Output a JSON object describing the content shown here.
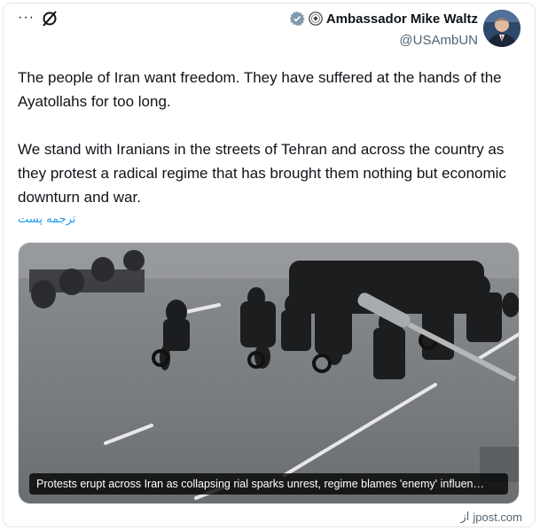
{
  "header": {
    "more_label": "···",
    "display_name": "Ambassador Mike Waltz",
    "handle": "@USAmbUN",
    "verified_color": "#829aab"
  },
  "post": {
    "paragraph_1": "The people of Iran want freedom. They have suffered at the hands of the Ayatollahs for too long.",
    "paragraph_2": "We stand with Iranians in the streets of Tehran and across the country as they protest a radical regime that has brought them nothing but economic downturn and war.",
    "translate_label": "ترجمه پست"
  },
  "card": {
    "caption": "Protests erupt across Iran as collapsing rial sparks unrest, regime blames 'enemy' influen…",
    "source_prefix": "از",
    "source_domain": "jpost.com"
  },
  "icons": {
    "more": "more-icon",
    "grok": "grok-icon",
    "verified": "verified-badge-icon",
    "seal": "government-seal-icon"
  }
}
